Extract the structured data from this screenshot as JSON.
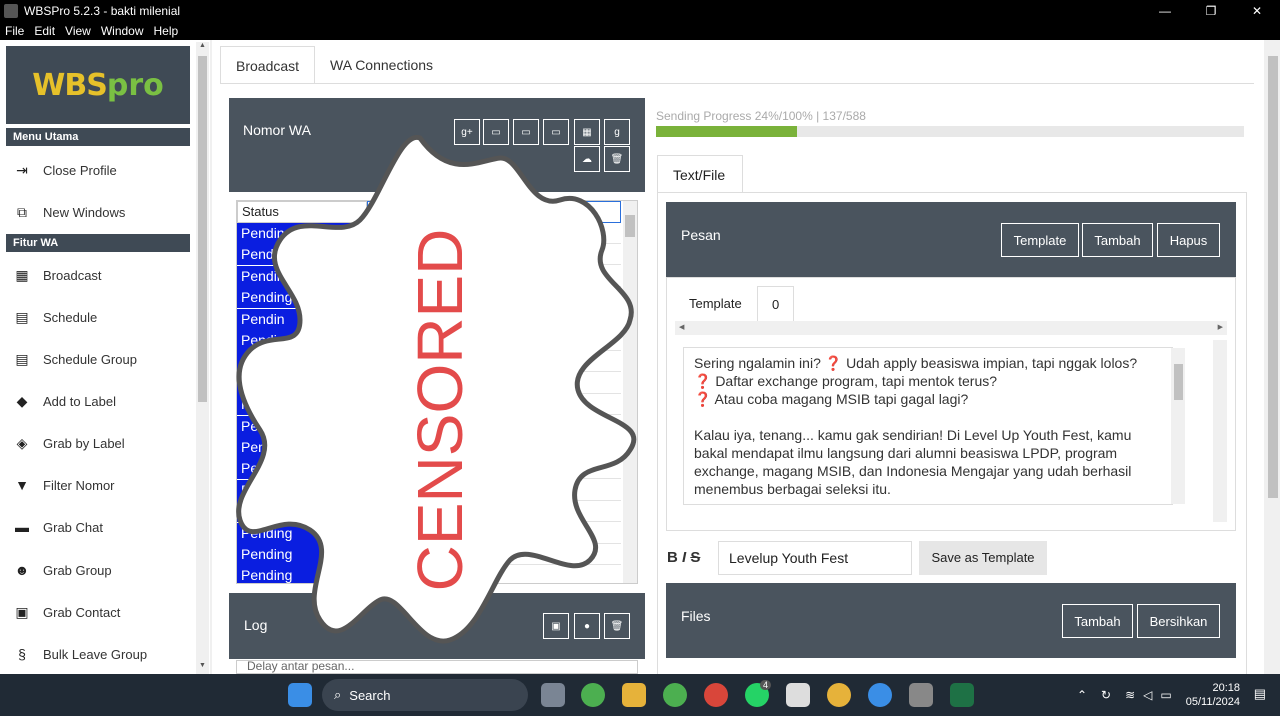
{
  "window": {
    "title": "WBSPro 5.2.3 - bakti milenial",
    "minimize": "—",
    "maximize": "❐",
    "close": "✕"
  },
  "menu": [
    "File",
    "Edit",
    "View",
    "Window",
    "Help"
  ],
  "logo": {
    "brand_a": "WBS",
    "brand_b": "pro"
  },
  "sidebar": {
    "section_main": "Menu Utama",
    "main_items": [
      {
        "label": "Close Profile",
        "icon": "exit-icon"
      },
      {
        "label": "New Windows",
        "icon": "windows-icon"
      }
    ],
    "section_wa": "Fitur WA",
    "wa_items": [
      {
        "label": "Broadcast",
        "icon": "grid-icon"
      },
      {
        "label": "Schedule",
        "icon": "calendar-icon"
      },
      {
        "label": "Schedule Group",
        "icon": "calendar-icon"
      },
      {
        "label": "Add to Label",
        "icon": "tag-icon"
      },
      {
        "label": "Grab by Label",
        "icon": "tags-icon"
      },
      {
        "label": "Filter Nomor",
        "icon": "filter-icon"
      },
      {
        "label": "Grab Chat",
        "icon": "chat-icon"
      },
      {
        "label": "Grab Group",
        "icon": "users-icon"
      },
      {
        "label": "Grab Contact",
        "icon": "contact-card-icon"
      },
      {
        "label": "Bulk Leave Group",
        "icon": "leave-icon"
      }
    ]
  },
  "tabs": [
    "Broadcast",
    "WA Connections"
  ],
  "nomor": {
    "title": "Nomor WA"
  },
  "grid": {
    "header": "Status",
    "rows": [
      "Pending",
      "Pendin",
      "Pending",
      "Pending",
      "Pendin",
      "Pendi",
      "Pen",
      "P",
      "Pend",
      "Pendi",
      "Pending",
      "Pendin",
      "Pendin",
      "Pendin",
      "Pending",
      "Pending",
      "Pending"
    ]
  },
  "censor_text": "CENSORED",
  "log": {
    "title": "Log",
    "line": "Delay antar pesan..."
  },
  "progress": {
    "label": "Sending Progress 24%/100% | 137/588",
    "fraction": 0.24
  },
  "right_tab": "Text/File",
  "pesan": {
    "title": "Pesan",
    "btn_template": "Template",
    "btn_tambah": "Tambah",
    "btn_hapus": "Hapus"
  },
  "template_tabs": [
    "Template",
    "0"
  ],
  "message_lines": [
    "Sering ngalamin ini? ❓ Udah apply beasiswa impian, tapi nggak lolos?",
    "❓ Daftar exchange program, tapi mentok terus?",
    "❓ Atau coba magang MSIB tapi gagal lagi?",
    "",
    "Kalau iya, tenang... kamu gak sendirian! Di Level Up Youth Fest, kamu",
    "bakal mendapat ilmu langsung dari alumni beasiswa LPDP, program",
    "exchange, magang MSIB, dan Indonesia Mengajar yang udah berhasil",
    "menembus berbagai seleksi itu."
  ],
  "format": {
    "bold": "B",
    "italic": "I",
    "strike": "S"
  },
  "subject_value": "Levelup Youth Fest",
  "save_template": "Save as Template",
  "files": {
    "title": "Files",
    "btn_tambah": "Tambah",
    "btn_bersihkan": "Bersihkan"
  },
  "taskbar": {
    "search": "Search",
    "time": "20:18",
    "date": "05/11/2024",
    "whatsapp_badge": "4"
  }
}
